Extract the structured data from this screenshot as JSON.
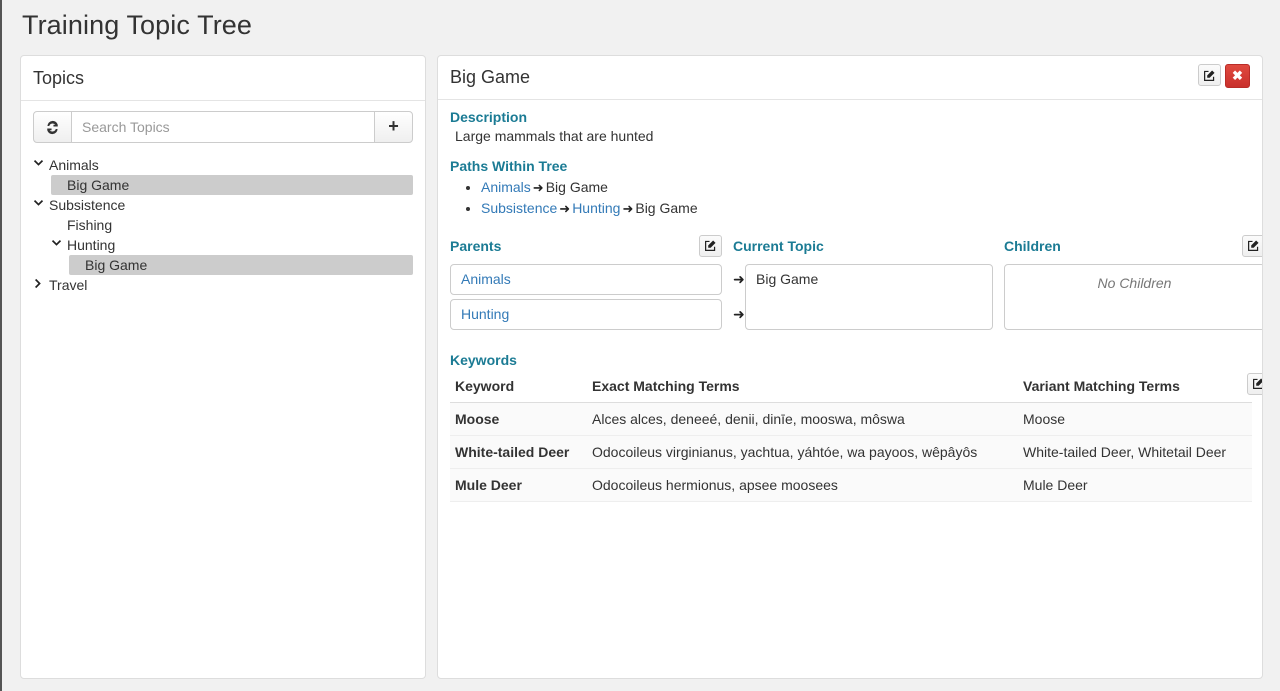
{
  "page": {
    "title": "Training Topic Tree"
  },
  "topics_panel": {
    "heading": "Topics",
    "refresh_icon": "refresh-icon",
    "add_icon": "plus-icon",
    "search": {
      "value": "",
      "placeholder": "Search Topics"
    },
    "tree": [
      {
        "label": "Animals",
        "depth": 0,
        "caret": "down",
        "selected": false
      },
      {
        "label": "Big Game",
        "depth": 1,
        "caret": "none",
        "selected": true
      },
      {
        "label": "Subsistence",
        "depth": 0,
        "caret": "down",
        "selected": false
      },
      {
        "label": "Fishing",
        "depth": 1,
        "caret": "none",
        "selected": false
      },
      {
        "label": "Hunting",
        "depth": 1,
        "caret": "down",
        "selected": false
      },
      {
        "label": "Big Game",
        "depth": 2,
        "caret": "none",
        "selected": true
      },
      {
        "label": "Travel",
        "depth": 0,
        "caret": "right",
        "selected": false
      }
    ]
  },
  "detail_panel": {
    "title": "Big Game",
    "edit_icon": "edit-square-icon",
    "close_label": "✖",
    "description_heading": "Description",
    "description_text": "Large mammals that are hunted",
    "paths_heading": "Paths Within Tree",
    "paths": [
      {
        "segments": [
          "Animals",
          "Big Game"
        ],
        "link_flags": [
          true,
          false
        ]
      },
      {
        "segments": [
          "Subsistence",
          "Hunting",
          "Big Game"
        ],
        "link_flags": [
          true,
          true,
          false
        ]
      }
    ],
    "relations": {
      "parents_heading": "Parents",
      "parents": [
        "Animals",
        "Hunting"
      ],
      "current_heading": "Current Topic",
      "current": "Big Game",
      "children_heading": "Children",
      "children_empty_text": "No Children"
    },
    "keywords": {
      "heading": "Keywords",
      "columns": [
        "Keyword",
        "Exact Matching Terms",
        "Variant Matching Terms"
      ],
      "rows": [
        {
          "keyword": "Moose",
          "exact": "Alces alces, deneeé, denii, dinīe, mooswa, môswa",
          "variant": "Moose"
        },
        {
          "keyword": "White-tailed Deer",
          "exact": "Odocoileus virginianus, yachtua, yáhtóe, wa payoos, wêpâyôs",
          "variant": "White-tailed Deer, Whitetail Deer"
        },
        {
          "keyword": "Mule Deer",
          "exact": "Odocoileus hermionus, apsee moosees",
          "variant": "Mule Deer"
        }
      ]
    }
  },
  "colors": {
    "section_heading": "#1b7b94",
    "link": "#337ab7",
    "danger": "#c9302c",
    "selected_row": "#cccccc",
    "page_bg": "#f1f1f1"
  },
  "glyphs": {
    "caret_down": "⌄",
    "caret_right": "›",
    "arrow_right": "➜",
    "plus": "+"
  }
}
